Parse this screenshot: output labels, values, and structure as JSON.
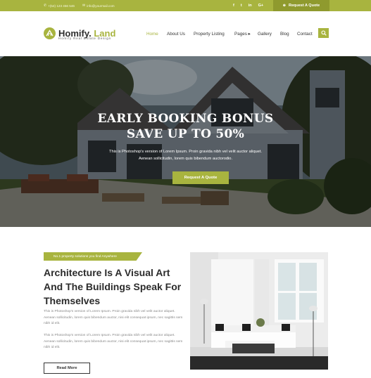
{
  "topbar": {
    "phone": "+(54) 123 456 546",
    "email": "info@yourmail.com",
    "social_icons": [
      "facebook-icon",
      "twitter-icon",
      "linkedin-icon",
      "google-plus-icon"
    ],
    "social_glyphs": [
      "f",
      "t",
      "in",
      "G+"
    ],
    "quote_label": "Request A Quote"
  },
  "header": {
    "logo_name": "Homify.",
    "logo_accent": " Land",
    "logo_tagline": "Homify Real Estate Design",
    "nav": [
      {
        "label": "Home",
        "active": true
      },
      {
        "label": "About Us"
      },
      {
        "label": "Property Listing"
      },
      {
        "label": "Pages ▸"
      },
      {
        "label": "Gallery"
      },
      {
        "label": "Blog"
      },
      {
        "label": "Contact"
      }
    ]
  },
  "hero": {
    "title_line1": "EARLY BOOKING BONUS",
    "title_line2": "SAVE UP TO 50%",
    "text": "This is Photoshop's version of Lorem Ipsum. Proin gravida nibh vel velit auctor aliquet. Aenean sollicitudin, lorem quis bibendum auctorodio.",
    "button_label": "Request A Quote"
  },
  "about": {
    "tag": "No.1 property solutions you find Anywhere",
    "title": "Architecture Is A Visual Art And The Buildings Speak For Themselves",
    "paragraph1": "This is Photoshop's version of Lorem Ipsum. Proin gravida nibh vel velit auctor aliquet. Aenean sollicitudin, lorem quis bibendum auctor, nisi elit consequat ipsum, nec sagittis sem nibh id elit.",
    "paragraph2": "This is Photoshop's version of Lorem Ipsum. Proin gravida nibh vel velit auctor aliquet. Aenean sollicitudin, lorem quis bibendum auctor, nisi elit consequat ipsum, nec sagittis sem nibh id elit.",
    "read_more": "Read More"
  },
  "colors": {
    "accent": "#a8b43f",
    "accent_dark": "#8f9a2e",
    "text_dark": "#2b2b2b",
    "text_muted": "#888888"
  }
}
